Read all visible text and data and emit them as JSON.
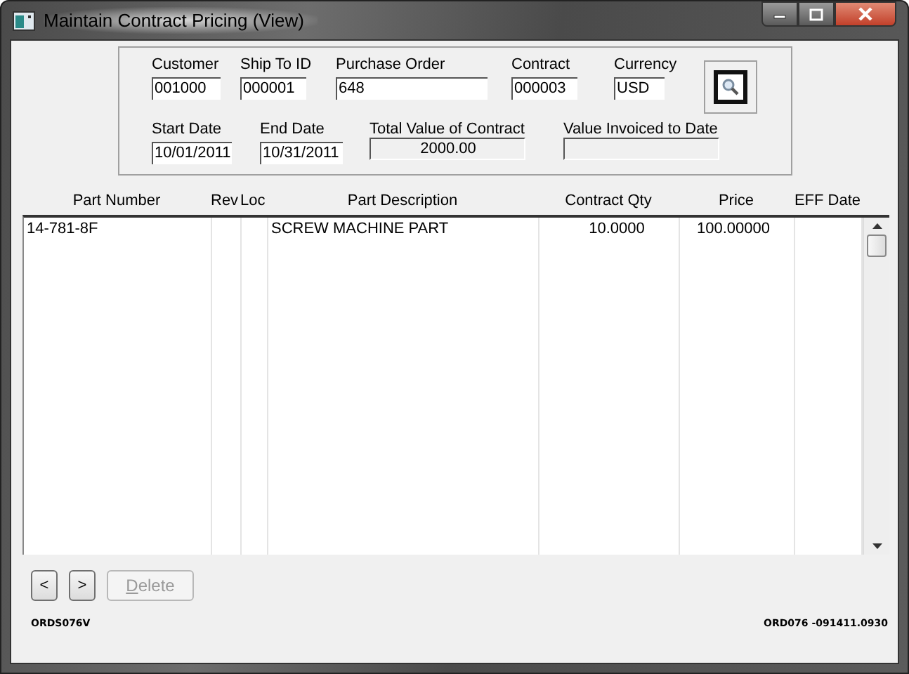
{
  "window": {
    "title": "Maintain Contract Pricing (View)"
  },
  "header_rows": [
    [
      {
        "label": "Customer",
        "value": "001000",
        "kind": "input"
      },
      {
        "label": "Ship To ID",
        "value": "000001",
        "kind": "input"
      },
      {
        "label": "Purchase Order",
        "value": "648",
        "kind": "input"
      },
      {
        "label": "Contract",
        "value": "000003",
        "kind": "input"
      },
      {
        "label": "Currency",
        "value": "USD",
        "kind": "input"
      }
    ],
    [
      {
        "label": "Start Date",
        "value": "10/01/2011",
        "kind": "input"
      },
      {
        "label": "End Date",
        "value": "10/31/2011",
        "kind": "input"
      },
      {
        "label": "Total Value of Contract",
        "value": "2000.00",
        "kind": "readonly"
      },
      {
        "label": "Value Invoiced to Date",
        "kind": "readonly"
      }
    ]
  ],
  "table": {
    "columns": [
      "Part Number",
      "Rev",
      "Loc",
      "Part Description",
      "Contract Qty",
      "Price",
      "EFF Date"
    ],
    "rows": [
      [
        "14-781-8F",
        "",
        "",
        "SCREW MACHINE PART",
        "10.0000",
        "100.00000",
        ""
      ]
    ]
  },
  "buttons": [
    {
      "label": "<",
      "disabled": false
    },
    {
      "label": ">",
      "disabled": false
    },
    {
      "label": "Delete",
      "disabled": true
    }
  ],
  "status_bar": {
    "left": "ORDS076V",
    "right": "ORD076 -091411.0930"
  }
}
